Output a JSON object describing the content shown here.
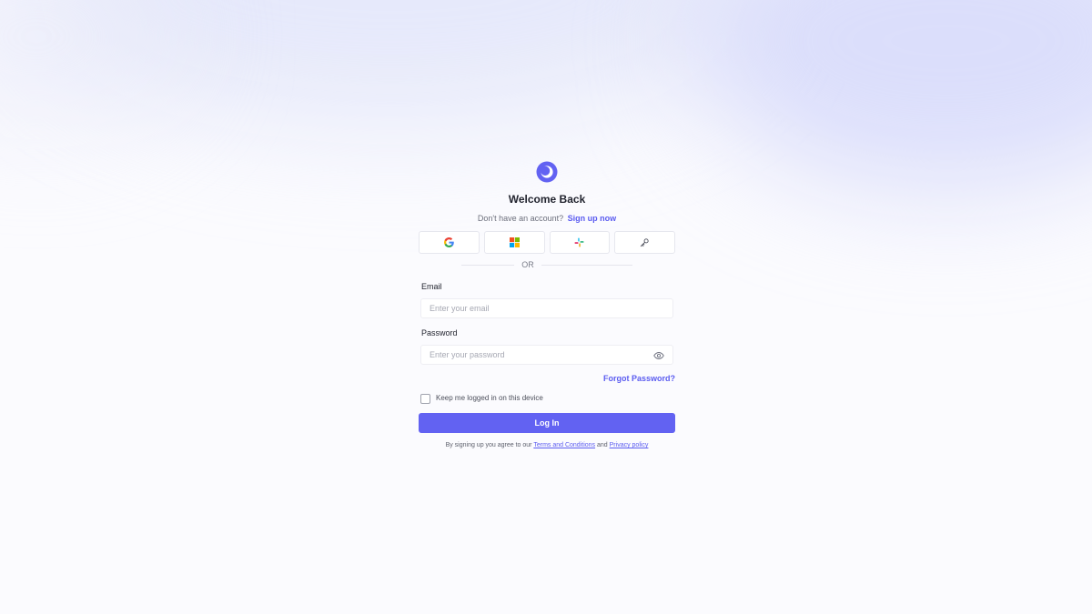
{
  "app": {
    "title": "Welcome Back"
  },
  "signup": {
    "prompt": "Don't have an account?",
    "link": "Sign up now"
  },
  "social": [
    {
      "provider": "google",
      "icon": "google-icon"
    },
    {
      "provider": "microsoft",
      "icon": "microsoft-icon"
    },
    {
      "provider": "slack",
      "icon": "slack-icon"
    },
    {
      "provider": "sso-key",
      "icon": "key-icon"
    }
  ],
  "divider": {
    "label": "OR"
  },
  "email": {
    "label": "Email",
    "placeholder": "Enter your email",
    "value": ""
  },
  "password": {
    "label": "Password",
    "placeholder": "Enter your password",
    "value": "",
    "toggle_icon": "eye-icon"
  },
  "forgot": {
    "label": "Forgot Password?"
  },
  "remember": {
    "label": "Keep me logged in on this device",
    "checked": false
  },
  "submit": {
    "label": "Log In"
  },
  "terms": {
    "prefix": "By signing up you agree to our",
    "terms_link": "Terms and Conditions",
    "middle": "and",
    "privacy_link": "Privacy policy"
  },
  "colors": {
    "accent": "#6262f2",
    "link": "#5b5cf0",
    "text": "#22242f",
    "muted": "#6c6f7c",
    "border": "#e6e7ee",
    "background": "#fbfbfe"
  }
}
